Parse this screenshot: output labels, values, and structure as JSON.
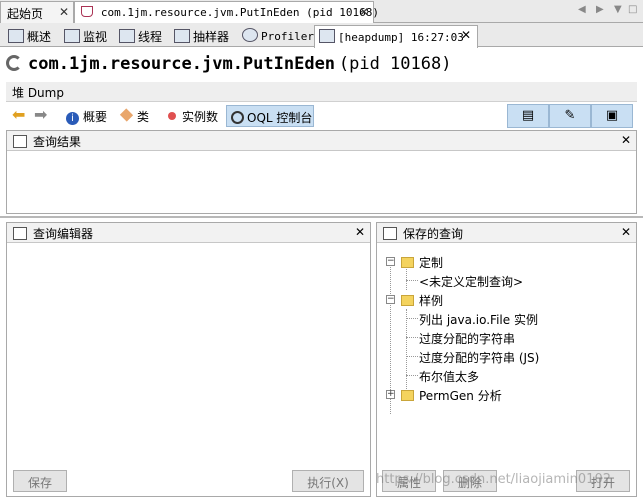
{
  "top_tabs": [
    {
      "label": "起始页",
      "active": false
    },
    {
      "label": "com.1jm.resource.jvm.PutInEden (pid 10168)",
      "active": true
    }
  ],
  "sub_tabs": [
    {
      "label": "概述",
      "icon": "overview-icon"
    },
    {
      "label": "监视",
      "icon": "monitor-icon"
    },
    {
      "label": "线程",
      "icon": "threads-icon"
    },
    {
      "label": "抽样器",
      "icon": "sampler-icon"
    },
    {
      "label": "Profiler",
      "icon": "profiler-icon"
    },
    {
      "label": "[heapdump] 16:27:03",
      "icon": "heapdump-icon",
      "active": true
    }
  ],
  "header": {
    "title": "com.1jm.resource.jvm.PutInEden",
    "pid": "(pid 10168)"
  },
  "heap_bar": {
    "label": "堆 Dump"
  },
  "toolbar": {
    "summary": "概要",
    "classes": "类",
    "instances": "实例数",
    "oql": "OQL 控制台"
  },
  "results_panel": {
    "title": "查询结果"
  },
  "editor_panel": {
    "title": "查询编辑器",
    "save_button": "保存",
    "execute_button": "执行(X)"
  },
  "saved_panel": {
    "title": "保存的查询",
    "custom_folder": "定制",
    "custom_item": "<未定义定制查询>",
    "samples_folder": "样例",
    "sample_items": [
      "列出 java.io.File 实例",
      "过度分配的字符串",
      "过度分配的字符串 (JS)",
      "布尔值太多"
    ],
    "permgen_folder": "PermGen 分析",
    "properties_button": "属性",
    "delete_button": "删除",
    "open_button": "打开"
  },
  "watermark": "https://blog.csdn.net/liaojiamin0102",
  "colors": {
    "selected_bg": "#c9dff3",
    "folder": "#f4d35e"
  }
}
